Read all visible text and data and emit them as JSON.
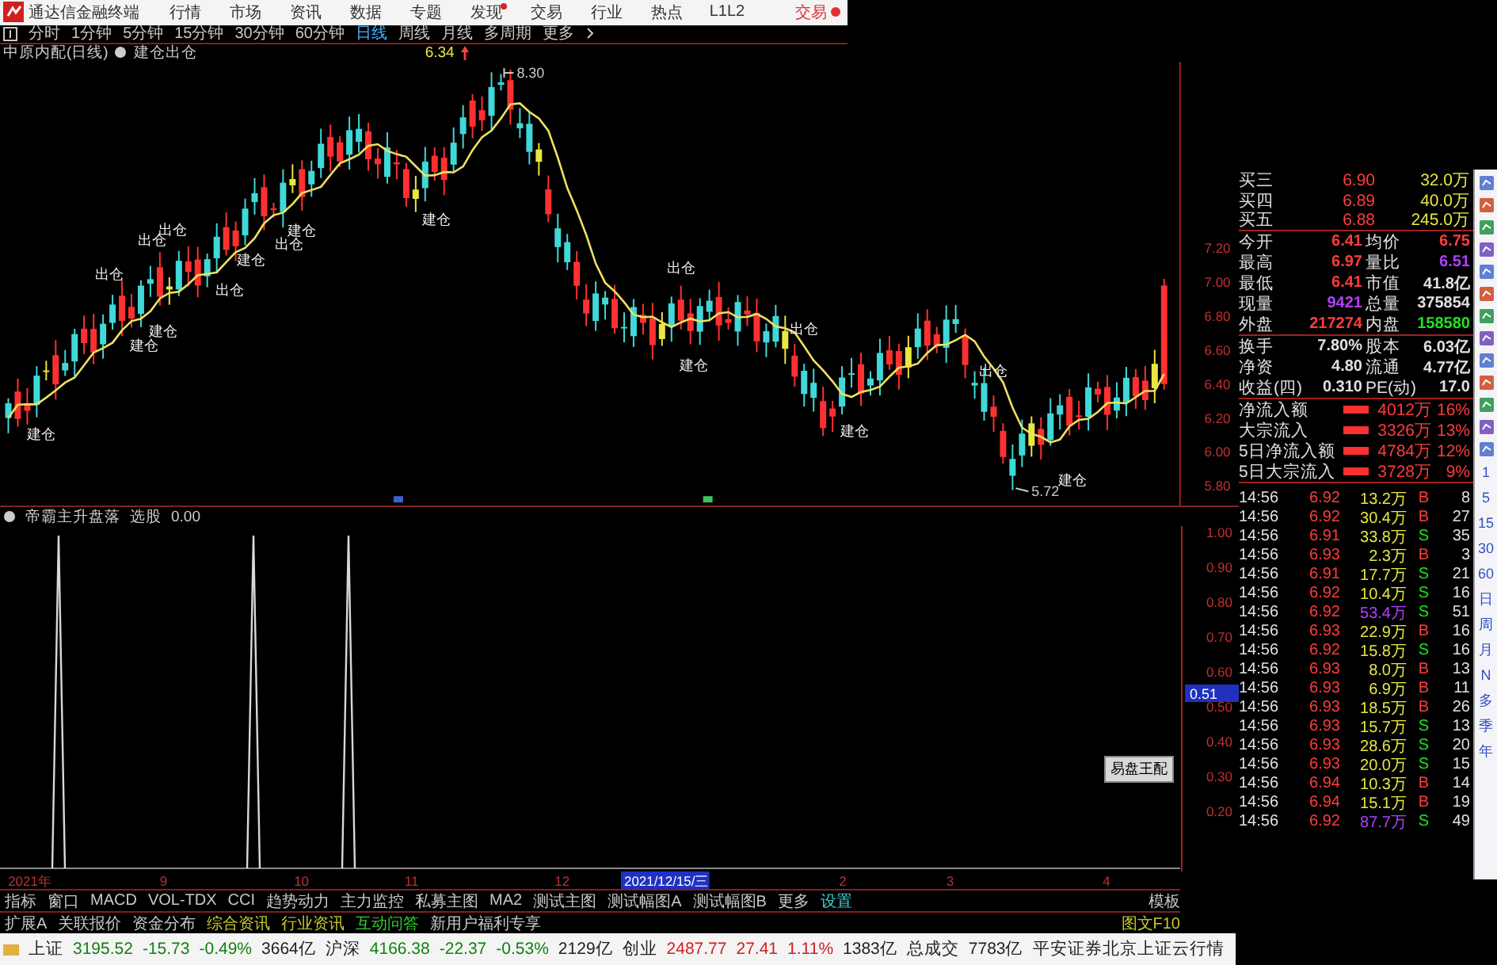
{
  "menu": {
    "title": "通达信金融终端",
    "items": [
      {
        "label": "行情",
        "badge": false
      },
      {
        "label": "市场",
        "badge": false
      },
      {
        "label": "资讯",
        "badge": false
      },
      {
        "label": "数据",
        "badge": false
      },
      {
        "label": "专题",
        "badge": false
      },
      {
        "label": "发现",
        "badge": true
      },
      {
        "label": "交易",
        "badge": false
      },
      {
        "label": "行业",
        "badge": false
      },
      {
        "label": "热点",
        "badge": false
      },
      {
        "label": "L1L2",
        "badge": false
      }
    ],
    "trade": "交易"
  },
  "periods": [
    {
      "label": "分时",
      "selected": false
    },
    {
      "label": "1分钟",
      "selected": false
    },
    {
      "label": "5分钟",
      "selected": false
    },
    {
      "label": "15分钟",
      "selected": false
    },
    {
      "label": "30分钟",
      "selected": false
    },
    {
      "label": "60分钟",
      "selected": false
    },
    {
      "label": "日线",
      "selected": true
    },
    {
      "label": "周线",
      "selected": false
    },
    {
      "label": "月线",
      "selected": false
    },
    {
      "label": "多周期",
      "selected": false
    },
    {
      "label": "更多",
      "selected": false
    }
  ],
  "chart_header": {
    "stock": "中原内配(日线)",
    "formula": "建仓出仓",
    "price": "6.34"
  },
  "main_chart": {
    "high_label": "8.30",
    "low_label": "5.72",
    "axis": [
      "7.20",
      "7.00",
      "6.80",
      "6.60",
      "6.40",
      "6.20",
      "6.00",
      "5.80"
    ],
    "signals": [
      {
        "label": "建仓"
      },
      {
        "label": "出仓"
      },
      {
        "label": "建仓"
      },
      {
        "label": "出仓"
      },
      {
        "label": "建仓"
      },
      {
        "label": "出仓"
      },
      {
        "label": "出仓"
      },
      {
        "label": "建仓"
      },
      {
        "label": "出仓"
      },
      {
        "label": "建仓"
      },
      {
        "label": "建仓"
      },
      {
        "label": "出仓"
      },
      {
        "label": "建仓"
      },
      {
        "label": "出仓"
      },
      {
        "label": "建仓"
      },
      {
        "label": "出仓"
      },
      {
        "label": "建仓"
      }
    ]
  },
  "indicator": {
    "name": "帝霸主升盘落",
    "mode": "选股",
    "value": "0.00",
    "axis": [
      "1.00",
      "0.90",
      "0.80",
      "0.70",
      "0.60",
      "0.50",
      "0.40",
      "0.30",
      "0.20"
    ],
    "cursor_value": "0.51",
    "popup": "易盘王配"
  },
  "date_axis": {
    "labels": [
      "2021年",
      "9",
      "10",
      "11",
      "12",
      "2",
      "3",
      "4"
    ],
    "cursor_date": "2021/12/15/三"
  },
  "tabs": [
    {
      "label": "指标",
      "color": "#c8c8c8"
    },
    {
      "label": "窗口",
      "color": "#c8c8c8"
    },
    {
      "label": "MACD",
      "color": "#c8c8c8"
    },
    {
      "label": "VOL-TDX",
      "color": "#c8c8c8"
    },
    {
      "label": "CCI",
      "color": "#c8c8c8"
    },
    {
      "label": "趋势动力",
      "color": "#c8c8c8"
    },
    {
      "label": "主力监控",
      "color": "#c8c8c8"
    },
    {
      "label": "私募主图",
      "color": "#c8c8c8"
    },
    {
      "label": "MA2",
      "color": "#c8c8c8"
    },
    {
      "label": "测试主图",
      "color": "#c8c8c8"
    },
    {
      "label": "测试幅图A",
      "color": "#c8c8c8"
    },
    {
      "label": "测试幅图B",
      "color": "#c8c8c8"
    },
    {
      "label": "更多",
      "color": "#c8c8c8"
    },
    {
      "label": "设置",
      "color": "#40d0d0"
    }
  ],
  "tabs_right": "模板",
  "info_tabs": [
    {
      "label": "扩展A",
      "color": "#c8c8c8"
    },
    {
      "label": "关联报价",
      "color": "#c8c8c8"
    },
    {
      "label": "资金分布",
      "color": "#c8c8c8"
    },
    {
      "label": "综合资讯",
      "color": "#c8c832"
    },
    {
      "label": "行业资讯",
      "color": "#c8c832"
    },
    {
      "label": "互动问答",
      "color": "#33cc33"
    },
    {
      "label": "新用户福利专享",
      "color": "#c8c8c8"
    }
  ],
  "info_right": "图文F10",
  "asks": [
    {
      "label": "买三",
      "price": "6.90",
      "volume": "32.0万"
    },
    {
      "label": "买四",
      "price": "6.89",
      "volume": "40.0万"
    },
    {
      "label": "买五",
      "price": "6.88",
      "volume": "245.0万"
    }
  ],
  "stats": [
    {
      "label": "今开",
      "value": "6.41",
      "color": "#ff3c3c"
    },
    {
      "label": "均价",
      "value": "6.75",
      "color": "#ff3c3c"
    },
    {
      "label": "最高",
      "value": "6.97",
      "color": "#ff3c3c"
    },
    {
      "label": "量比",
      "value": "6.51",
      "color": "#b040ff"
    },
    {
      "label": "最低",
      "value": "6.41",
      "color": "#ff3c3c"
    },
    {
      "label": "市值",
      "value": "41.8亿",
      "color": "#e0e0e0"
    },
    {
      "label": "现量",
      "value": "9421",
      "color": "#b040ff"
    },
    {
      "label": "总量",
      "value": "375854",
      "color": "#e0e0e0"
    },
    {
      "label": "外盘",
      "value": "217274",
      "color": "#ff3c3c"
    },
    {
      "label": "内盘",
      "value": "158580",
      "color": "#20e020"
    },
    {
      "label": "换手",
      "value": "7.80%",
      "color": "#e0e0e0"
    },
    {
      "label": "股本",
      "value": "6.03亿",
      "color": "#e0e0e0"
    },
    {
      "label": "净资",
      "value": "4.80",
      "color": "#e0e0e0"
    },
    {
      "label": "流通",
      "value": "4.77亿",
      "color": "#e0e0e0"
    },
    {
      "label": "收益(四)",
      "value": "0.310",
      "color": "#e0e0e0"
    },
    {
      "label": "PE(动)",
      "value": "17.0",
      "color": "#e0e0e0"
    }
  ],
  "flows": [
    {
      "label": "净流入额",
      "amount": "4012万",
      "pct": "16%"
    },
    {
      "label": "大宗流入",
      "amount": "3326万",
      "pct": "13%"
    },
    {
      "label": "5日净流入额",
      "amount": "4784万",
      "pct": "12%"
    },
    {
      "label": "5日大宗流入",
      "amount": "3728万",
      "pct": "9%"
    }
  ],
  "trades": [
    {
      "time": "14:56",
      "price": "6.92",
      "volume": "13.2万",
      "side": "B",
      "kind": "buy",
      "count": "8",
      "large": false
    },
    {
      "time": "14:56",
      "price": "6.92",
      "volume": "30.4万",
      "side": "B",
      "kind": "buy",
      "count": "27",
      "large": false
    },
    {
      "time": "14:56",
      "price": "6.91",
      "volume": "33.8万",
      "side": "S",
      "kind": "sell",
      "count": "35",
      "large": false
    },
    {
      "time": "14:56",
      "price": "6.93",
      "volume": "2.3万",
      "side": "B",
      "kind": "buy",
      "count": "3",
      "large": false
    },
    {
      "time": "14:56",
      "price": "6.91",
      "volume": "17.7万",
      "side": "S",
      "kind": "sell",
      "count": "21",
      "large": false
    },
    {
      "time": "14:56",
      "price": "6.92",
      "volume": "10.4万",
      "side": "S",
      "kind": "sell",
      "count": "16",
      "large": false
    },
    {
      "time": "14:56",
      "price": "6.92",
      "volume": "53.4万",
      "side": "S",
      "kind": "sell",
      "count": "51",
      "large": true
    },
    {
      "time": "14:56",
      "price": "6.93",
      "volume": "22.9万",
      "side": "B",
      "kind": "buy",
      "count": "16",
      "large": false
    },
    {
      "time": "14:56",
      "price": "6.92",
      "volume": "15.8万",
      "side": "S",
      "kind": "sell",
      "count": "16",
      "large": false
    },
    {
      "time": "14:56",
      "price": "6.93",
      "volume": "8.0万",
      "side": "B",
      "kind": "buy",
      "count": "13",
      "large": false
    },
    {
      "time": "14:56",
      "price": "6.93",
      "volume": "6.9万",
      "side": "B",
      "kind": "buy",
      "count": "11",
      "large": false
    },
    {
      "time": "14:56",
      "price": "6.93",
      "volume": "18.5万",
      "side": "B",
      "kind": "buy",
      "count": "26",
      "large": false
    },
    {
      "time": "14:56",
      "price": "6.93",
      "volume": "15.7万",
      "side": "S",
      "kind": "sell",
      "count": "13",
      "large": false
    },
    {
      "time": "14:56",
      "price": "6.93",
      "volume": "28.6万",
      "side": "S",
      "kind": "sell",
      "count": "20",
      "large": false
    },
    {
      "time": "14:56",
      "price": "6.93",
      "volume": "20.0万",
      "side": "S",
      "kind": "sell",
      "count": "15",
      "large": false
    },
    {
      "time": "14:56",
      "price": "6.94",
      "volume": "10.3万",
      "side": "B",
      "kind": "buy",
      "count": "14",
      "large": false
    },
    {
      "time": "14:56",
      "price": "6.94",
      "volume": "15.1万",
      "side": "B",
      "kind": "buy",
      "count": "19",
      "large": false
    },
    {
      "time": "14:56",
      "price": "6.92",
      "volume": "87.7万",
      "side": "S",
      "kind": "sell",
      "count": "49",
      "large": true
    }
  ],
  "side_periods": [
    "1",
    "5",
    "15",
    "30",
    "60",
    "日",
    "周",
    "月",
    "N",
    "多",
    "季",
    "年"
  ],
  "status": [
    {
      "text": "上证",
      "color": "#202020"
    },
    {
      "text": "3195.52",
      "color": "#108010"
    },
    {
      "text": "-15.73",
      "color": "#108010"
    },
    {
      "text": "-0.49%",
      "color": "#108010"
    },
    {
      "text": "3664亿",
      "color": "#202020"
    },
    {
      "text": "沪深",
      "color": "#202020"
    },
    {
      "text": "4166.38",
      "color": "#108010"
    },
    {
      "text": "-22.37",
      "color": "#108010"
    },
    {
      "text": "-0.53%",
      "color": "#108010"
    },
    {
      "text": "2129亿",
      "color": "#202020"
    },
    {
      "text": "创业",
      "color": "#202020"
    },
    {
      "text": "2487.77",
      "color": "#d02020"
    },
    {
      "text": "27.41",
      "color": "#d02020"
    },
    {
      "text": "1.11%",
      "color": "#d02020"
    },
    {
      "text": "1383亿",
      "color": "#202020"
    },
    {
      "text": "总成交",
      "color": "#202020"
    },
    {
      "text": "7783亿",
      "color": "#202020"
    },
    {
      "text": "平安证券北京上证云行情",
      "color": "#202020"
    }
  ]
}
